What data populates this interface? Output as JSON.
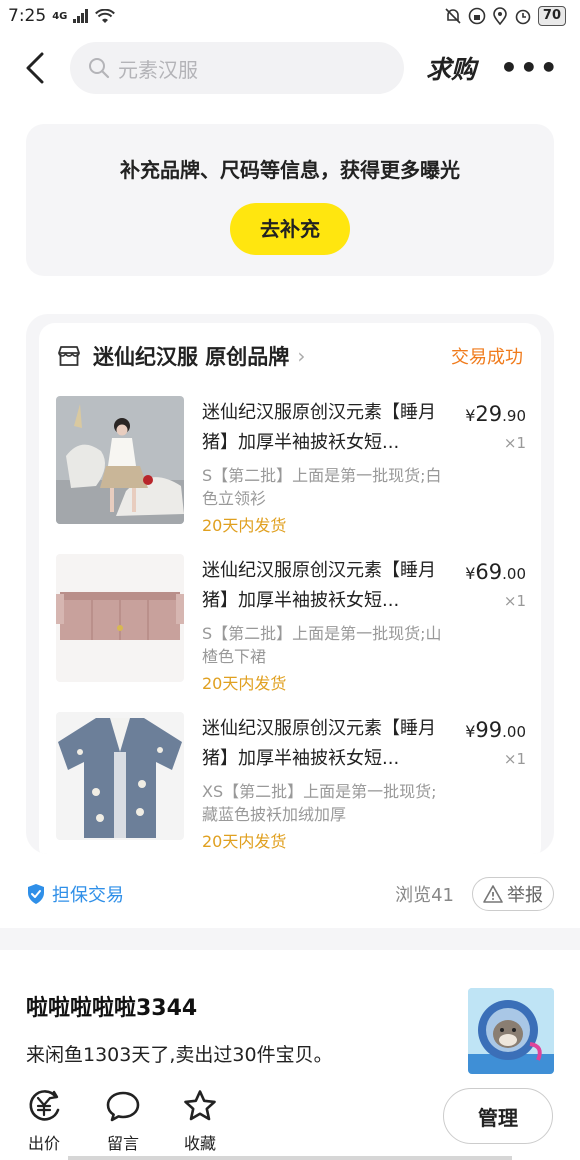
{
  "status_bar": {
    "time": "7:25",
    "network": "4G",
    "battery": "70"
  },
  "header": {
    "search_placeholder": "元素汉服",
    "want_buy_label": "求购",
    "more_label": "•••"
  },
  "supplement": {
    "prompt": "补充品牌、尺码等信息，获得更多曝光",
    "button_label": "去补充"
  },
  "order": {
    "shop_name": "迷仙纪汉服 原创品牌",
    "chevron": "›",
    "status": "交易成功",
    "items": [
      {
        "title": "迷仙纪汉服原创汉元素【睡月猪】加厚半袖披袄女短...",
        "sku": "S【第二批】上面是第一批现货;白色立领衫",
        "shipping": "20天内发货",
        "price_symbol": "¥",
        "price_int": "29",
        "price_dec": ".90",
        "qty": "×1"
      },
      {
        "title": "迷仙纪汉服原创汉元素【睡月猪】加厚半袖披袄女短...",
        "sku": "S【第二批】上面是第一批现货;山楂色下裙",
        "shipping": "20天内发货",
        "price_symbol": "¥",
        "price_int": "69",
        "price_dec": ".00",
        "qty": "×1"
      },
      {
        "title": "迷仙纪汉服原创汉元素【睡月猪】加厚半袖披袄女短...",
        "sku": "XS【第二批】上面是第一批现货;藏蓝色披袄加绒加厚",
        "shipping": "20天内发货",
        "price_symbol": "¥",
        "price_int": "99",
        "price_dec": ".00",
        "qty": "×1"
      }
    ]
  },
  "footer_info": {
    "guarantee": "担保交易",
    "views": "浏览41",
    "report": "举报"
  },
  "seller": {
    "name": "啦啦啦啦啦3344",
    "info": "来闲鱼1303天了,卖出过30件宝贝。"
  },
  "bottom_actions": {
    "offer": "出价",
    "comment": "留言",
    "favorite": "收藏",
    "manage": "管理"
  },
  "colors": {
    "accent_yellow": "#ffe60f",
    "status_orange": "#f07b1c",
    "guarantee_blue": "#2f8fe8",
    "shipping_gold": "#e0a020"
  }
}
